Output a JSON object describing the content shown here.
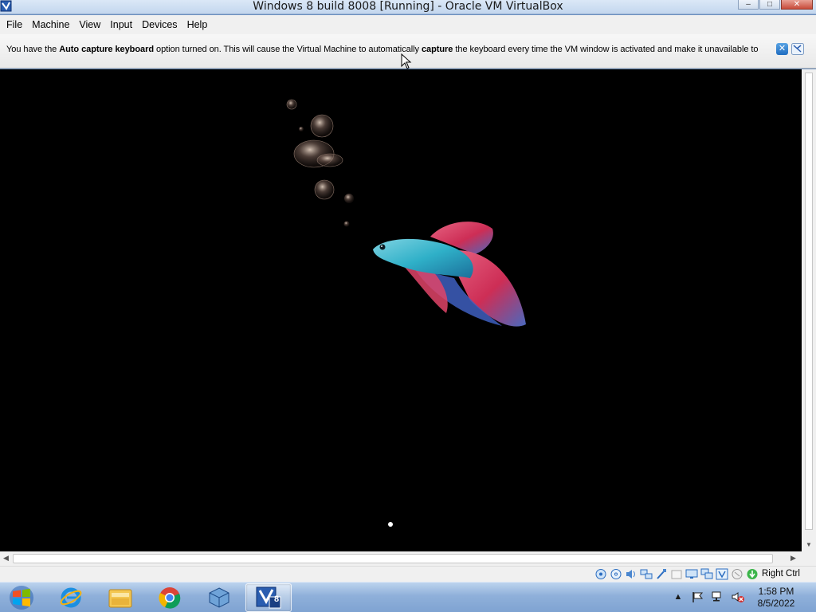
{
  "window": {
    "title": "Windows 8 build 8008 [Running] - Oracle VM VirtualBox",
    "minimize_glyph": "–",
    "maximize_glyph": "□",
    "close_glyph": "✕"
  },
  "menu": {
    "items": [
      {
        "label": "File"
      },
      {
        "label": "Machine"
      },
      {
        "label": "View"
      },
      {
        "label": "Input"
      },
      {
        "label": "Devices"
      },
      {
        "label": "Help"
      }
    ]
  },
  "notification": {
    "part1": "You have the ",
    "bold1": "Auto capture keyboard",
    "part2": " option turned on. This will cause the Virtual Machine to automatically ",
    "bold2": "capture",
    "part3": " the keyboard every time the VM window is activated and make it unavailable to",
    "close_glyph": "✕"
  },
  "status_bar": {
    "icons": [
      "hard-disk-icon",
      "optical-drive-icon",
      "audio-icon",
      "network-icon",
      "usb-icon",
      "shared-folder-icon",
      "display-icon",
      "video-capture-icon",
      "virtualization-icon",
      "mouse-integration-icon",
      "keyboard-capture-icon"
    ],
    "host_key": "Right Ctrl"
  },
  "taskbar": {
    "apps": [
      "internet-explorer-icon",
      "file-explorer-icon",
      "chrome-icon",
      "virtualbox-icon",
      "windows8-vm-icon"
    ],
    "vm_badge": "8",
    "tray_arrow": "▲",
    "clock_time": "1:58 PM",
    "clock_date": "8/5/2022"
  },
  "colors": {
    "titlebar": "#c3d6ee",
    "taskbar": "#8fb0da",
    "vm_background": "#000000",
    "fish_body": "#2fb0c8",
    "fish_fin": "#d8305a"
  }
}
